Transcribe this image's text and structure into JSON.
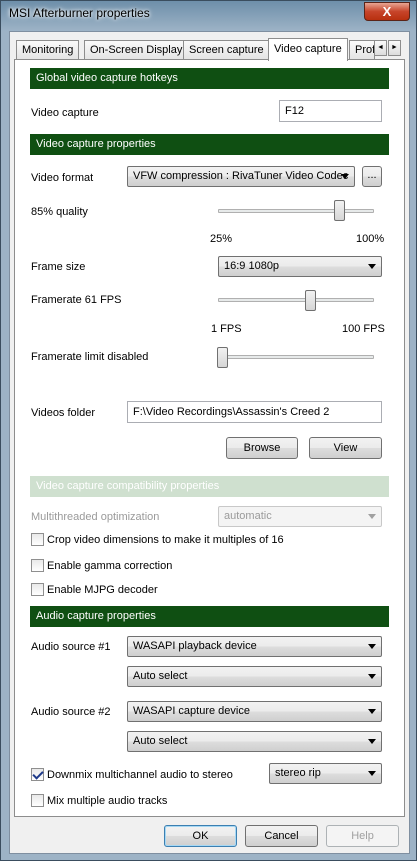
{
  "window": {
    "title": "MSI Afterburner properties",
    "close_glyph": "X"
  },
  "tabs": [
    {
      "label": "Monitoring"
    },
    {
      "label": "On-Screen Display"
    },
    {
      "label": "Screen capture"
    },
    {
      "label": "Video capture",
      "active": true
    },
    {
      "label": "Prof"
    }
  ],
  "tab_scroll": {
    "left": "◄",
    "right": "►"
  },
  "sections": {
    "hotkeys": "Global video capture hotkeys",
    "properties": "Video capture properties",
    "compat": "Video capture compatibility properties",
    "audio": "Audio capture properties"
  },
  "hotkeys": {
    "video_capture_label": "Video capture",
    "video_capture_value": "F12"
  },
  "properties": {
    "video_format_label": "Video format",
    "video_format_value": "VFW compression : RivaTuner Video Codec",
    "browse_format_label": "...",
    "quality_label": "85% quality",
    "quality_min": "25%",
    "quality_max": "100%",
    "quality_value": 85,
    "frame_size_label": "Frame size",
    "frame_size_value": "16:9 1080p",
    "framerate_label": "Framerate 61 FPS",
    "framerate_min": "1 FPS",
    "framerate_max": "100 FPS",
    "framerate_value": 61,
    "framerate_limit_label": "Framerate limit disabled",
    "videos_folder_label": "Videos folder",
    "videos_folder_value": "F:\\Video Recordings\\Assassin's Creed 2",
    "browse_label": "Browse",
    "view_label": "View"
  },
  "compat": {
    "multithreaded_label": "Multithreaded optimization",
    "multithreaded_value": "automatic",
    "crop_label": "Crop video dimensions to make it multiples of 16",
    "crop_checked": false,
    "gamma_label": "Enable gamma correction",
    "gamma_checked": false,
    "mjpg_label": "Enable MJPG decoder",
    "mjpg_checked": false
  },
  "audio": {
    "source1_label": "Audio source #1",
    "source1_device": "WASAPI playback device",
    "source1_select": "Auto select",
    "source2_label": "Audio source #2",
    "source2_device": "WASAPI capture device",
    "source2_select": "Auto select",
    "downmix_label": "Downmix multichannel audio to stereo",
    "downmix_checked": true,
    "downmix_mode": "stereo rip",
    "mix_label": "Mix multiple audio tracks",
    "mix_checked": false
  },
  "footer": {
    "ok_label": "OK",
    "cancel_label": "Cancel",
    "help_label": "Help"
  },
  "colors": {
    "section_header": "#0f4f12",
    "title_bar": "#9db3c6",
    "close_button": "#c7442a"
  }
}
